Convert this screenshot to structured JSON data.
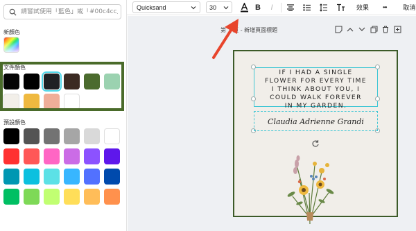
{
  "search": {
    "placeholder": "請嘗試使用「藍色」或「#00c4cc」"
  },
  "sections": {
    "new_color": "新顏色",
    "document_colors": "文件顏色",
    "default_colors": "預設顏色"
  },
  "document_colors": [
    "#050505",
    "#000000",
    "#1f2124",
    "#3b2a22",
    "#4b6b2e",
    "#9bd2b0",
    "#f2efe9",
    "#efb940",
    "#efae99",
    "#ffffff"
  ],
  "default_colors": [
    "#000000",
    "#545454",
    "#737373",
    "#a6a6a6",
    "#d9d9d9",
    "#ffffff",
    "#ff3131",
    "#ff5757",
    "#ff66c4",
    "#cb6ce6",
    "#8c52ff",
    "#5e17eb",
    "#0097b2",
    "#0cc0df",
    "#5ce1e6",
    "#38b6ff",
    "#5271ff",
    "#004aad",
    "#00bf63",
    "#7ed957",
    "#c1ff72",
    "#ffde59",
    "#ffbd59",
    "#ff914d"
  ],
  "toolbar": {
    "font": "Quicksand",
    "size": "30",
    "effects": "效果",
    "more": "•••",
    "cancel": "取消"
  },
  "page": {
    "title": "第 1 頁 - 新增頁面標題"
  },
  "design": {
    "quote_lines": [
      "IF I HAD A SINGLE",
      "FLOWER FOR EVERY TIME",
      "I THINK ABOUT YOU, I",
      "COULD WALK FOREVER",
      "IN MY GARDEN."
    ],
    "signature": "Claudia Adrienne Grandi"
  },
  "colors": {
    "highlight_border": "#4a6b2a",
    "selection": "#3ec6d4",
    "arrow": "#e8452c"
  }
}
